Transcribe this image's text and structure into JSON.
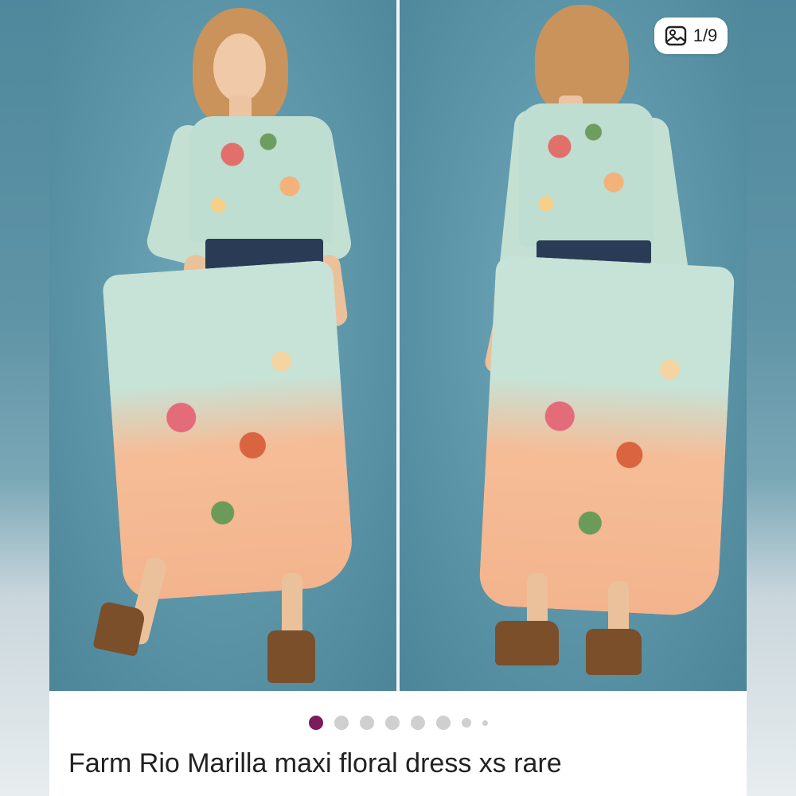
{
  "listing": {
    "title": "Farm Rio Marilla maxi floral dress xs rare"
  },
  "gallery": {
    "counter": "1/9",
    "counter_icon": "image-icon",
    "total_dots": 8,
    "active_index": 0
  },
  "colors": {
    "accent": "#7b1c5c",
    "dot_inactive": "#cfcfcf"
  }
}
